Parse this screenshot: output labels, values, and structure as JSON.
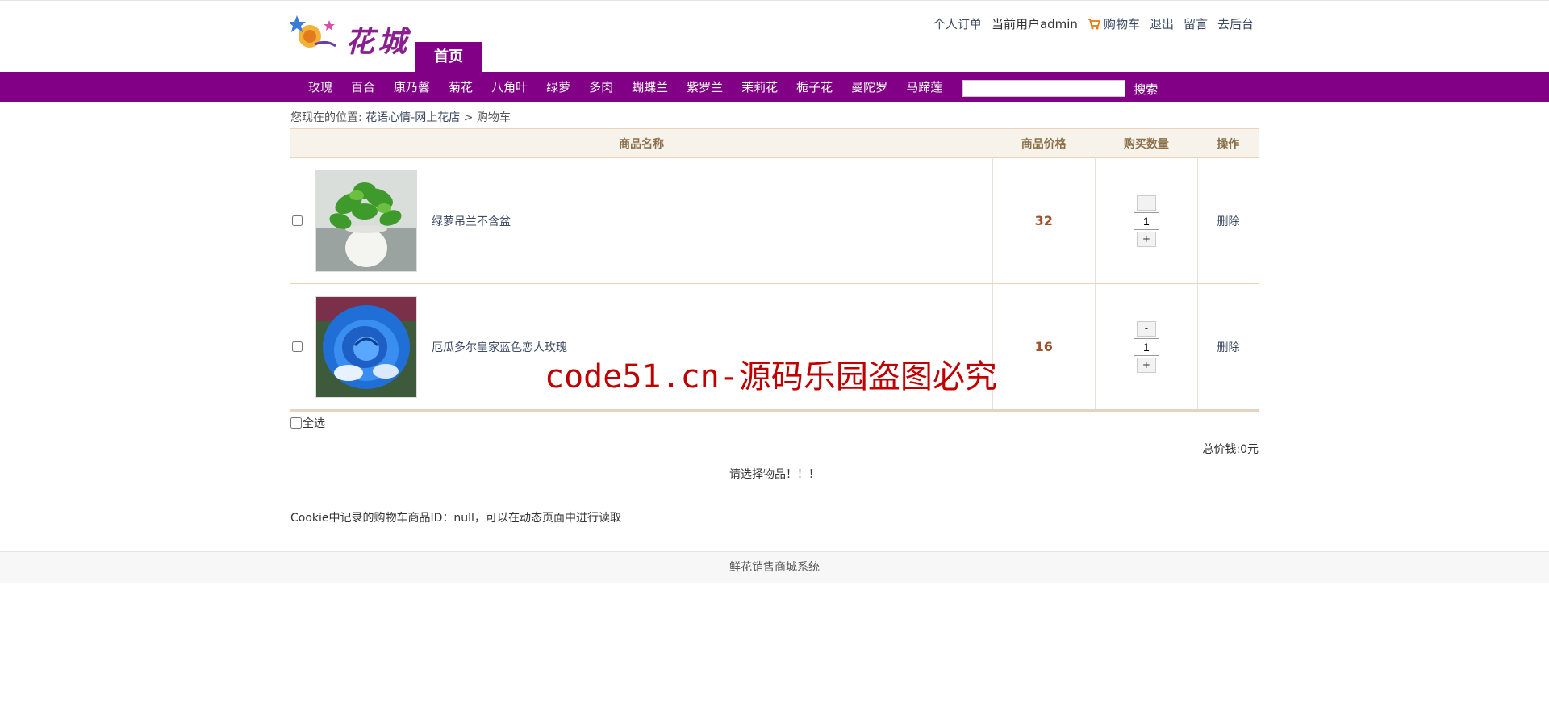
{
  "header": {
    "logo_text": "花城",
    "home_tab": "首页",
    "top_links": {
      "orders": "个人订单",
      "current_user": "当前用户admin",
      "cart": "购物车",
      "logout": "退出",
      "message": "留言",
      "admin": "去后台"
    }
  },
  "nav": {
    "items": [
      "玫瑰",
      "百合",
      "康乃馨",
      "菊花",
      "八角叶",
      "绿萝",
      "多肉",
      "蝴蝶兰",
      "紫罗兰",
      "茉莉花",
      "栀子花",
      "曼陀罗",
      "马蹄莲"
    ],
    "search_value": "",
    "search_button": "搜索"
  },
  "breadcrumb": {
    "prefix": "您现在的位置:",
    "shop": "花语心情-网上花店",
    "sep": ">",
    "current": "购物车"
  },
  "table": {
    "headers": [
      "商品名称",
      "商品价格",
      "购买数量",
      "操作"
    ],
    "rows": [
      {
        "name": "绿萝吊兰不含盆",
        "price": "32",
        "quantity": "1",
        "action": "删除",
        "minus": "-",
        "plus": "+",
        "image": "green-pothos-plant"
      },
      {
        "name": "厄瓜多尔皇家蓝色恋人玫瑰",
        "price": "16",
        "quantity": "1",
        "action": "删除",
        "minus": "-",
        "plus": "+",
        "image": "blue-rose"
      }
    ]
  },
  "select_all_label": "全选",
  "total": "总价钱:0元",
  "prompt": "请选择物品！！！",
  "cookie_note": "Cookie中记录的购物车商品ID：null，可以在动态页面中进行读取",
  "footer": "鲜花销售商城系统",
  "watermark": "code51.cn-源码乐园盗图必究",
  "colors": {
    "brand": "#820085",
    "price": "#a0522d",
    "link": "#3d4a63",
    "watermark": "#c00000"
  }
}
